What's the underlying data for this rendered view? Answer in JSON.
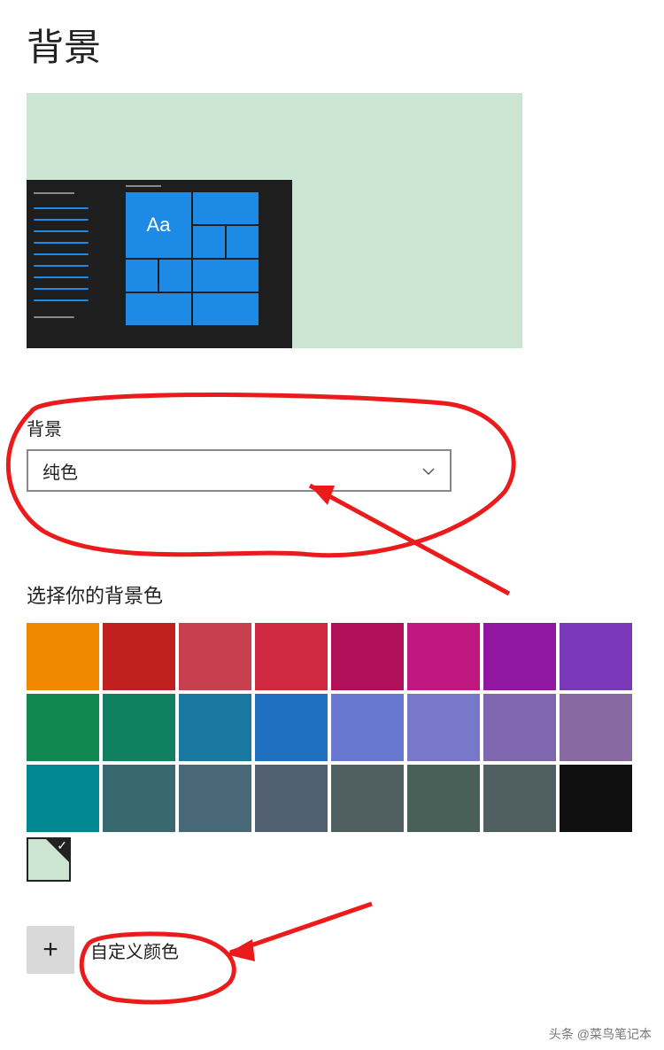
{
  "title": "背景",
  "background_section": {
    "label": "背景",
    "dropdown_value": "纯色"
  },
  "palette_section": {
    "label": "选择你的背景色",
    "colors": [
      "#f08800",
      "#c02020",
      "#c84050",
      "#d02840",
      "#b01058",
      "#c01880",
      "#9018a0",
      "#7838b8",
      "#108850",
      "#108060",
      "#1878a0",
      "#2070c0",
      "#6878d0",
      "#7878c8",
      "#8068b0",
      "#8868a0",
      "#008890",
      "#3a6870",
      "#486878",
      "#506070",
      "#506060",
      "#486058",
      "#506060",
      "#101010"
    ],
    "selected_color": "#cce5d3"
  },
  "custom": {
    "label": "自定义颜色"
  },
  "preview": {
    "sample_text": "Aa"
  },
  "watermark": "头条 @菜鸟笔记本"
}
